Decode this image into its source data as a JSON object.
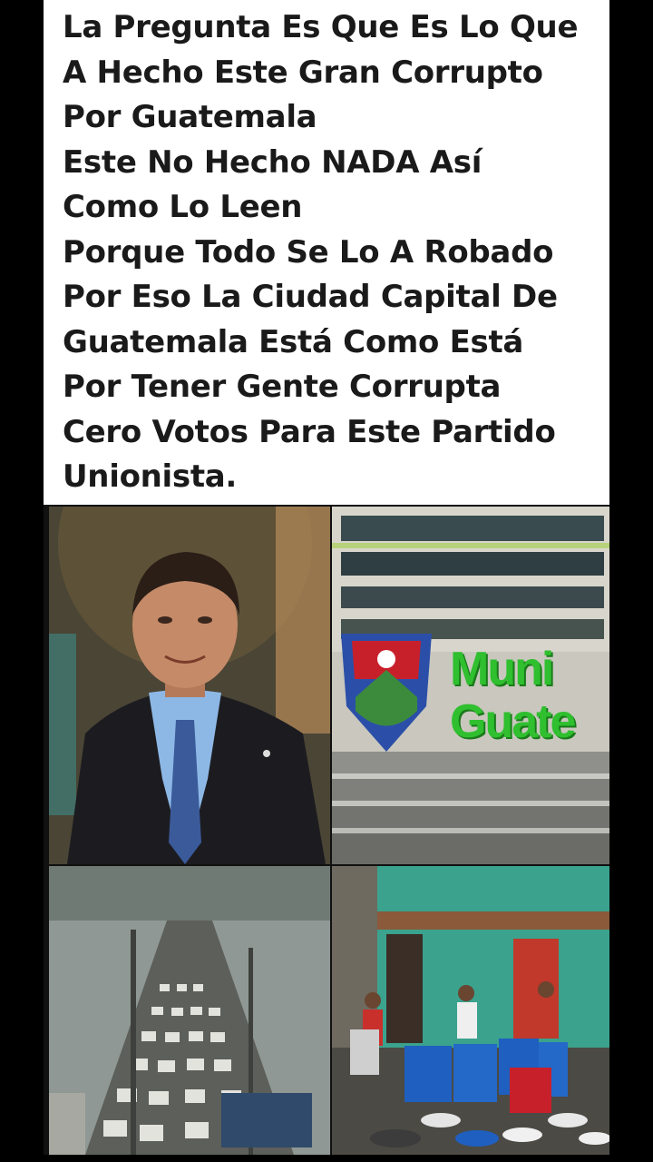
{
  "caption": {
    "lines": [
      "La Pregunta Es Que Es Lo Que",
      "A Hecho Este Gran Corrupto",
      "Por Guatemala",
      "Este No Hecho NADA Así",
      "Como Lo Leen",
      "Porque Todo Se Lo A Robado",
      "Por Eso La Ciudad Capital De",
      "Guatemala Está Como Está",
      "Por Tener Gente Corrupta",
      "Cero Votos Para Este Partido",
      "Unionista."
    ]
  },
  "collage": {
    "building_sign": "Muni Guate",
    "building_sign_line1": "Muni",
    "building_sign_line2": "Guate"
  },
  "colors": {
    "sign_green": "#2fbf2f",
    "shield_red": "#c8202b",
    "shield_blue": "#2b4fa8"
  }
}
